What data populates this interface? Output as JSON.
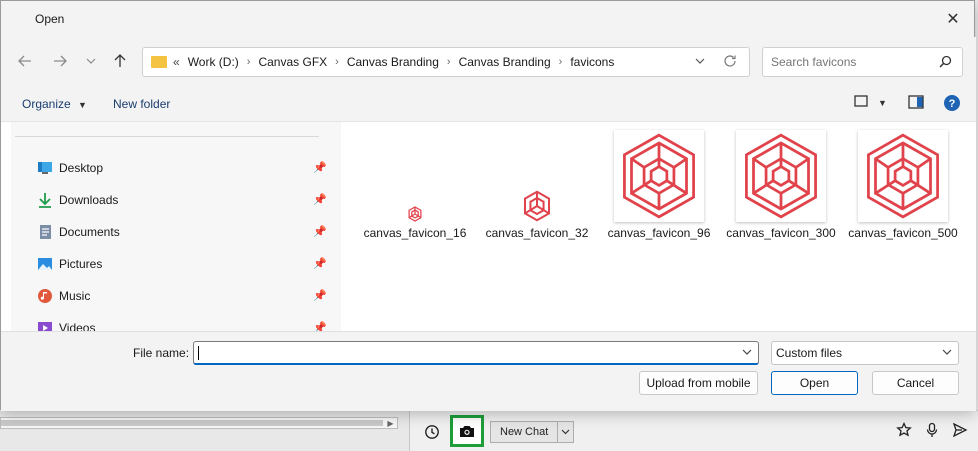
{
  "dialog": {
    "title": "Open",
    "close_label": "✕"
  },
  "address": {
    "prefix": "«",
    "crumbs": [
      "Work (D:)",
      "Canvas GFX",
      "Canvas Branding",
      "Canvas Branding",
      "favicons"
    ]
  },
  "search": {
    "placeholder": "Search favicons"
  },
  "commands": {
    "organize": "Organize",
    "new_folder": "New folder"
  },
  "nav_items": [
    {
      "label": "Desktop",
      "icon": "desktop-icon"
    },
    {
      "label": "Downloads",
      "icon": "download-icon"
    },
    {
      "label": "Documents",
      "icon": "document-icon"
    },
    {
      "label": "Pictures",
      "icon": "picture-icon"
    },
    {
      "label": "Music",
      "icon": "music-icon"
    },
    {
      "label": "Videos",
      "icon": "video-icon"
    }
  ],
  "files": [
    {
      "name": "canvas_favicon_16"
    },
    {
      "name": "canvas_favicon_32"
    },
    {
      "name": "canvas_favicon_96"
    },
    {
      "name": "canvas_favicon_300"
    },
    {
      "name": "canvas_favicon_500"
    }
  ],
  "footer": {
    "file_name_label": "File name:",
    "file_name_value": "",
    "filter_value": "Custom files",
    "upload_label": "Upload from mobile",
    "open_label": "Open",
    "cancel_label": "Cancel"
  },
  "chat": {
    "new_chat_label": "New Chat"
  },
  "colors": {
    "accent": "#0067c0",
    "logo": "#e0434b",
    "highlight": "#1e9e3a"
  }
}
